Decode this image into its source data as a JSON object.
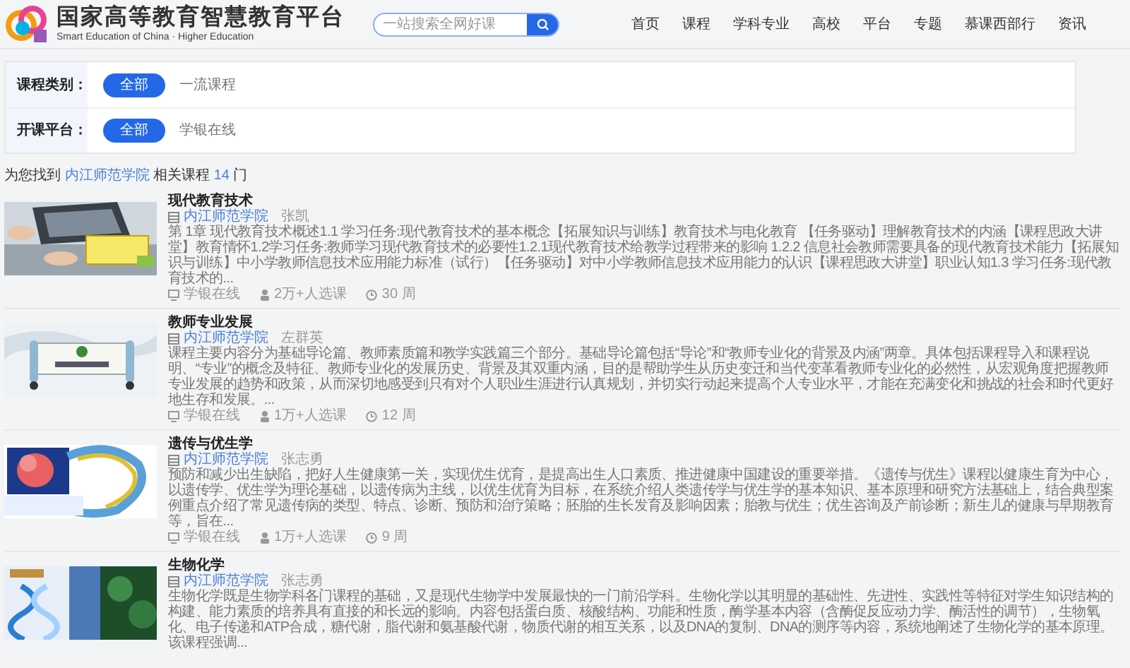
{
  "header": {
    "title": "国家高等教育智慧教育平台",
    "subtitle": "Smart Education of China · Higher Education",
    "search": {
      "placeholder": "一站搜索全网好课"
    },
    "nav": [
      {
        "label": "首页"
      },
      {
        "label": "课程"
      },
      {
        "label": "学科专业"
      },
      {
        "label": "高校"
      },
      {
        "label": "平台"
      },
      {
        "label": "专题"
      },
      {
        "label": "慕课西部行"
      },
      {
        "label": "资讯"
      }
    ]
  },
  "filters": [
    {
      "label": "课程类别：",
      "options": [
        {
          "label": "全部",
          "selected": true
        },
        {
          "label": "一流课程",
          "selected": false
        }
      ]
    },
    {
      "label": "开课平台：",
      "options": [
        {
          "label": "全部",
          "selected": true
        },
        {
          "label": "学银在线",
          "selected": false
        }
      ]
    }
  ],
  "result": {
    "prefix": "为您找到",
    "school": "内江师范学院",
    "middle": "相关课程",
    "count": "14",
    "suffix": "门"
  },
  "courses": [
    {
      "title": "现代教育技术",
      "school": "内江师范学院",
      "teacher": "张凯",
      "description": "第 1章 现代教育技术概述1.1 学习任务:现代教育技术的基本概念【拓展知识与训练】教育技术与电化教育 【任务驱动】理解教育技术的内涵【课程思政大讲堂】教育情怀1.2学习任务:教师学习现代教育技术的必要性1.2.1现代教育技术给教学过程带来的影响 1.2.2 信息社会教师需要具备的现代教育技术能力【拓展知识与训练】中小学教师信息技术应用能力标准（试行）【任务驱动】对中小学教师信息技术应用能力的认识【课程思政大讲堂】职业认知1.3 学习任务:现代教育技术的...",
      "platform": "学银在线",
      "enrolled": "2万+人选课",
      "weeks": "30 周"
    },
    {
      "title": "教师专业发展",
      "school": "内江师范学院",
      "teacher": "左群英",
      "description": "课程主要内容分为基础导论篇、教师素质篇和教学实践篇三个部分。基础导论篇包括“导论”和“教师专业化的背景及内涵”两章。具体包括课程导入和课程说明、“专业”的概念及特征、教师专业化的发展历史、背景及其双重内涵，目的是帮助学生从历史变迁和当代变革看教师专业化的必然性，从宏观角度把握教师专业发展的趋势和政策，从而深切地感受到只有对个人职业生涯进行认真规划，并切实行动起来提高个人专业水平，才能在充满变化和挑战的社会和时代更好地生存和发展。...",
      "platform": "学银在线",
      "enrolled": "1万+人选课",
      "weeks": "12 周"
    },
    {
      "title": "遗传与优生学",
      "school": "内江师范学院",
      "teacher": "张志勇",
      "description": "预防和减少出生缺陷，把好人生健康第一关，实现优生优育，是提高出生人口素质、推进健康中国建设的重要举措。《遗传与优生》课程以健康生育为中心，以遗传学、优生学为理论基础，以遗传病为主线，以优生优育为目标，在系统介绍人类遗传学与优生学的基本知识、基本原理和研究方法基础上，结合典型案例重点介绍了常见遗传病的类型、特点、诊断、预防和治疗策略；胚胎的生长发育及影响因素；胎教与优生；优生咨询及产前诊断；新生儿的健康与早期教育等，旨在...",
      "platform": "学银在线",
      "enrolled": "1万+人选课",
      "weeks": "9 周"
    },
    {
      "title": "生物化学",
      "school": "内江师范学院",
      "teacher": "张志勇",
      "description": "生物化学既是生物学科各门课程的基础，又是现代生物学中发展最快的一门前沿学科。生物化学以其明显的基础性、先进性、实践性等特征对学生知识结构的构建、能力素质的培养具有直接的和长远的影响。内容包括蛋白质、核酸结构、功能和性质，酶学基本内容（含酶促反应动力学、酶活性的调节），生物氧化、电子传递和ATP合成，糖代谢，脂代谢和氨基酸代谢，物质代谢的相互关系，以及DNA的复制、DNA的测序等内容，系统地阐述了生物化学的基本原理。该课程强调..."
    }
  ]
}
